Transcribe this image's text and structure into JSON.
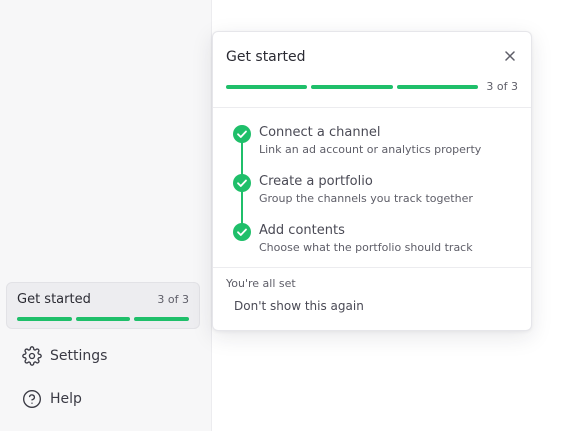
{
  "sidebar": {
    "get_started": {
      "title": "Get started",
      "count": "3 of 3",
      "progress": {
        "completed": 3,
        "total": 3
      }
    },
    "items": [
      {
        "label": "Settings",
        "icon": "gear-icon"
      },
      {
        "label": "Help",
        "icon": "help-circle-icon"
      }
    ]
  },
  "popover": {
    "title": "Get started",
    "close_icon": "close-icon",
    "count": "3 of 3",
    "progress": {
      "completed": 3,
      "total": 3
    },
    "steps": [
      {
        "title": "Connect a channel",
        "description": "Link an ad account or analytics property",
        "status": "done"
      },
      {
        "title": "Create a portfolio",
        "description": "Group the channels you track together",
        "status": "done"
      },
      {
        "title": "Add contents",
        "description": "Choose what the portfolio should track",
        "status": "done"
      }
    ],
    "footer": {
      "status_text": "You're all set",
      "dismiss_label": "Don't show this again"
    }
  },
  "colors": {
    "accent_green": "#1fbf6a",
    "sidebar_bg": "#f7f7f8",
    "track_gray": "#dadade"
  }
}
